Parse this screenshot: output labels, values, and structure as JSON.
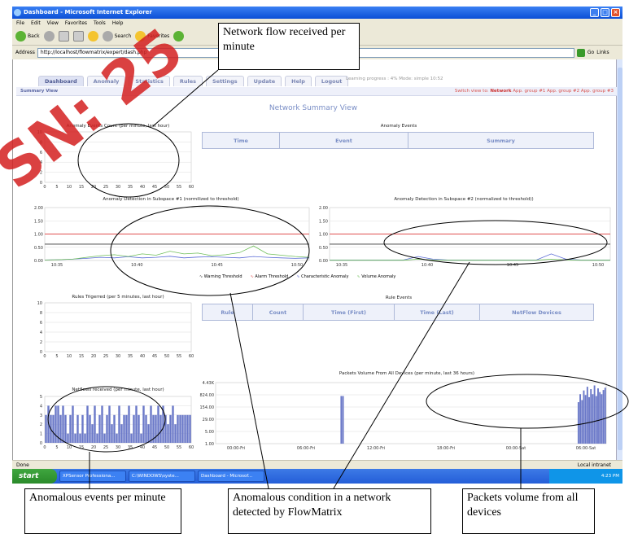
{
  "window": {
    "title": "Dashboard - Microsoft Internet Explorer"
  },
  "menu": [
    "File",
    "Edit",
    "View",
    "Favorites",
    "Tools",
    "Help"
  ],
  "toolbar": {
    "back": "Back",
    "search": "Search",
    "favorites": "Favorites"
  },
  "address": {
    "label": "Address",
    "url": "http://localhost/flowmatrix/expert/dash.php",
    "go": "Go",
    "links": "Links"
  },
  "tabs": [
    "Dashboard",
    "Anomaly",
    "Statistics",
    "Rules",
    "Settings",
    "Update",
    "Help",
    "Logout"
  ],
  "learning": "Learning progress : 4%   Mode: simple   10:52",
  "summary_bar": {
    "label": "Summary View",
    "switch_label": "Switch view to:",
    "views": [
      "Network",
      "App. group #1",
      "App. group #2",
      "App. group #3"
    ]
  },
  "page_title": "Network Summary View",
  "anomaly_events": {
    "title": "Anomaly Events",
    "headers": [
      "Time",
      "Event",
      "Summary"
    ]
  },
  "rule_events": {
    "title": "Rule Events",
    "headers": [
      "Rule",
      "Count",
      "Time (First)",
      "Time (Last)",
      "NetFlow Devices"
    ]
  },
  "legend": [
    "Warning Threshold",
    "Alarm Threshold",
    "Characteristic Anomaly",
    "Volume Anomaly"
  ],
  "colors": {
    "alarm": "#e05050",
    "warning": "#333333",
    "characteristic": "#5b6bd6",
    "volume": "#6fbf5a",
    "bars": "#6a78c8",
    "watermark": "#d42020"
  },
  "status": {
    "left": "Done",
    "zone": "Local intranet"
  },
  "taskbar": {
    "start": "start",
    "tasks": [
      "XPSensor Professiona...",
      "C:\\WINDOWS\\syste...",
      "Dashboard - Microsof..."
    ],
    "clock": "4:23 PM"
  },
  "callouts": {
    "top": "Network flow received per minute",
    "a": "Anomalous events per minute",
    "b": "Anomalous condition in a network detected by FlowMatrix",
    "c": "Packets volume from all devices"
  },
  "watermark": "SN: 25",
  "chart_data": [
    {
      "type": "line",
      "title": "Anomaly Events Count (per minute, last hour)",
      "x": [
        0,
        5,
        10,
        15,
        20,
        25,
        30,
        35,
        40,
        45,
        50,
        55,
        60
      ],
      "ylim": [
        0,
        10
      ],
      "yticks": [
        0,
        2,
        4,
        6,
        8,
        10
      ],
      "series": []
    },
    {
      "type": "line",
      "title": "Anomaly Detection in Subspace #1 (normilized to threshold)",
      "categories": [
        "10:35",
        "10:40",
        "10:45",
        "10:50"
      ],
      "ylim": [
        0,
        2
      ],
      "yticks": [
        "0.00",
        "0.50",
        "1.00",
        "1.50",
        "2.00"
      ],
      "series": [
        {
          "name": "Warning Threshold",
          "values": [
            0.62,
            0.62,
            0.62,
            0.62,
            0.62,
            0.62,
            0.62,
            0.62,
            0.62,
            0.62,
            0.62,
            0.62,
            0.62,
            0.62,
            0.62,
            0.62,
            0.62,
            0.62,
            0.62,
            0.62
          ]
        },
        {
          "name": "Alarm Threshold",
          "values": [
            1,
            1,
            1,
            1,
            1,
            1,
            1,
            1,
            1,
            1,
            1,
            1,
            1,
            1,
            1,
            1,
            1,
            1,
            1,
            1
          ]
        },
        {
          "name": "Characteristic Anomaly",
          "values": [
            0.02,
            0.03,
            0.05,
            0.08,
            0.12,
            0.1,
            0.14,
            0.1,
            0.12,
            0.16,
            0.1,
            0.13,
            0.14,
            0.12,
            0.1,
            0.15,
            0.12,
            0.1,
            0.08,
            0.1
          ]
        },
        {
          "name": "Volume Anomaly",
          "values": [
            0.02,
            0.03,
            0.05,
            0.12,
            0.18,
            0.22,
            0.15,
            0.25,
            0.2,
            0.35,
            0.25,
            0.28,
            0.18,
            0.22,
            0.3,
            0.55,
            0.25,
            0.2,
            0.15,
            0.12
          ]
        }
      ]
    },
    {
      "type": "line",
      "title": "Anomaly Detection in Subspace #2 (normalized to threshold))",
      "categories": [
        "10:35",
        "10:40",
        "10:45",
        "10:50"
      ],
      "ylim": [
        0,
        2
      ],
      "yticks": [
        "0.00",
        "0.50",
        "1.00",
        "1.50",
        "2.00"
      ],
      "series": [
        {
          "name": "Warning Threshold",
          "values": [
            0.62,
            0.62,
            0.62,
            0.62,
            0.62,
            0.62,
            0.62,
            0.62,
            0.62,
            0.62,
            0.62,
            0.62,
            0.62,
            0.62,
            0.62,
            0.62,
            0.62,
            0.62,
            0.62,
            0.62
          ]
        },
        {
          "name": "Alarm Threshold",
          "values": [
            1,
            1,
            1,
            1,
            1,
            1,
            1,
            1,
            1,
            1,
            1,
            1,
            1,
            1,
            1,
            1,
            1,
            1,
            1,
            1
          ]
        },
        {
          "name": "Characteristic Anomaly",
          "values": [
            0.02,
            0.02,
            0.02,
            0.02,
            0.02,
            0.02,
            0.15,
            0.05,
            0.02,
            0.02,
            0.02,
            0.02,
            0.02,
            0.02,
            0.02,
            0.25,
            0.05,
            0.02,
            0.02,
            0.02
          ]
        },
        {
          "name": "Volume Anomaly",
          "values": [
            0.01,
            0.01,
            0.01,
            0.01,
            0.01,
            0.01,
            0.05,
            0.02,
            0.01,
            0.01,
            0.01,
            0.01,
            0.01,
            0.01,
            0.01,
            0.05,
            0.02,
            0.01,
            0.01,
            0.01
          ]
        }
      ]
    },
    {
      "type": "line",
      "title": "Rules Trigerred (per 5 minutes, last hour)",
      "x": [
        0,
        5,
        10,
        15,
        20,
        25,
        30,
        35,
        40,
        45,
        50,
        55,
        60
      ],
      "ylim": [
        0,
        10
      ],
      "yticks": [
        0,
        2,
        4,
        6,
        8,
        10
      ],
      "series": []
    },
    {
      "type": "bar",
      "title": "Netflows received (per minute, last hour)",
      "x": [
        0,
        5,
        10,
        15,
        20,
        25,
        30,
        35,
        40,
        45,
        50,
        55,
        60
      ],
      "ylim": [
        0,
        5
      ],
      "yticks": [
        0,
        1,
        2,
        3,
        4,
        5
      ],
      "values": [
        3,
        4,
        3,
        3,
        4,
        4,
        3,
        4,
        3,
        1,
        3,
        4,
        1,
        3,
        1,
        3,
        1,
        4,
        3,
        2,
        4,
        1,
        3,
        4,
        1,
        3,
        4,
        2,
        3,
        1,
        4,
        2,
        3,
        3,
        4,
        1,
        3,
        4,
        3,
        1,
        4,
        3,
        2,
        4,
        3,
        3,
        4,
        3,
        4,
        3,
        2,
        3,
        4,
        2,
        3,
        3,
        3,
        3,
        3,
        3
      ]
    },
    {
      "type": "bar",
      "title": "Packets Volume From All Devices (per minute, last 36 hours)",
      "categories": [
        "00:00-Fri",
        "06:00-Fri",
        "12:00-Fri",
        "18:00-Fri",
        "00:00-Sat",
        "06:00-Sat"
      ],
      "yticks": [
        "1.00",
        "5.00",
        "29.00",
        "154.00",
        "824.00",
        "4.43K"
      ],
      "scale": "log",
      "values": [
        1,
        1,
        1,
        1,
        1,
        1,
        1,
        1,
        1,
        1,
        1,
        1,
        1,
        1,
        1,
        1,
        1,
        1,
        1,
        1,
        1,
        1,
        1,
        1,
        1,
        1,
        1,
        1,
        1,
        1,
        1,
        1,
        1,
        1,
        1,
        1,
        1,
        1,
        1,
        1,
        1,
        1,
        1,
        1,
        1,
        1,
        1,
        1,
        1,
        1,
        1,
        1,
        1,
        1,
        1,
        1,
        1,
        1,
        1,
        1,
        1,
        1,
        1,
        1,
        1,
        1,
        1,
        1,
        1,
        1,
        700,
        700,
        1,
        1,
        1,
        1,
        1,
        1,
        1,
        1,
        1,
        1,
        1,
        1,
        1,
        1,
        1,
        1,
        1,
        1,
        1,
        1,
        1,
        1,
        1,
        1,
        1,
        1,
        1,
        1,
        1,
        1,
        1,
        1,
        1,
        1,
        1,
        1,
        1,
        1,
        1,
        1,
        1,
        1,
        1,
        1,
        1,
        1,
        1,
        1,
        1,
        1,
        1,
        1,
        1,
        1,
        1,
        1,
        1,
        1,
        1,
        1,
        1,
        1,
        1,
        1,
        1,
        1,
        1,
        1,
        1,
        1,
        1,
        1,
        1,
        1,
        1,
        1,
        1,
        1,
        1,
        1,
        1,
        1,
        1,
        1,
        1,
        1,
        1,
        1,
        1,
        1,
        1,
        1,
        1,
        1,
        1,
        1,
        1,
        1,
        1,
        1,
        1,
        1,
        1,
        1,
        1,
        1,
        1,
        1,
        1,
        1,
        1,
        1,
        1,
        1,
        1,
        1,
        1,
        1,
        1,
        1,
        1,
        1,
        1,
        1,
        1,
        1,
        1,
        1,
        1,
        1,
        1,
        300,
        900,
        400,
        1500,
        800,
        2500,
        600,
        1800,
        900,
        3000,
        700,
        2000,
        1200,
        900,
        1600,
        2200
      ]
    }
  ]
}
